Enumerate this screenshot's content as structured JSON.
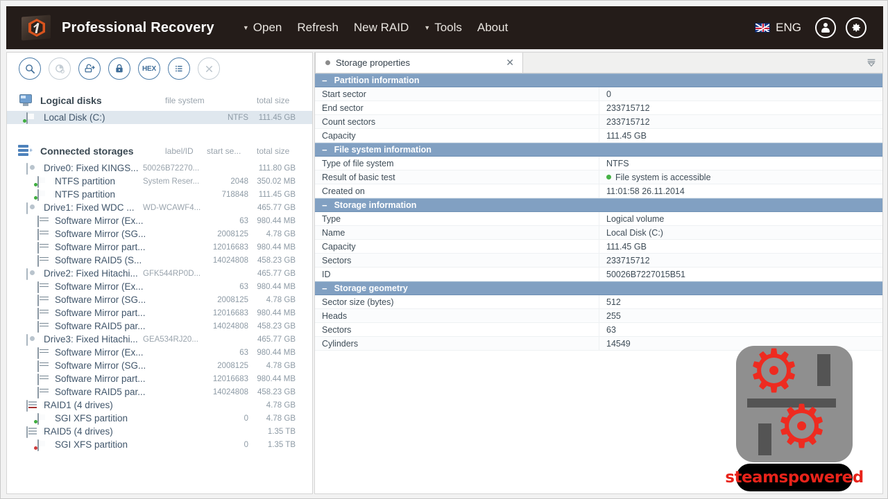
{
  "header": {
    "app_title": "Professional Recovery",
    "logo_icon": "recovery-folder-logo",
    "menu": [
      {
        "label": "Open",
        "caret": "▼"
      },
      {
        "label": "Refresh",
        "caret": ""
      },
      {
        "label": "New RAID",
        "caret": ""
      },
      {
        "label": "Tools",
        "caret": "▼"
      },
      {
        "label": "About",
        "caret": ""
      }
    ],
    "language": "ENG",
    "flag_icon": "uk-flag-icon",
    "user_icon": "user-icon",
    "settings_icon": "gear-icon"
  },
  "toolbar": {
    "buttons": [
      {
        "name": "search-icon",
        "glyph": "⌕",
        "disabled": false
      },
      {
        "name": "disk-usage-chart-icon",
        "glyph": "◔",
        "disabled": true
      },
      {
        "name": "disk-image-icon",
        "glyph": "⛃",
        "disabled": false
      },
      {
        "name": "lock-icon",
        "glyph": "ὑ2",
        "disabled": false
      },
      {
        "name": "hex-editor-icon",
        "glyph": "HEX",
        "disabled": false
      },
      {
        "name": "list-view-icon",
        "glyph": "☰",
        "disabled": false
      },
      {
        "name": "close-icon",
        "glyph": "✕",
        "disabled": true
      }
    ]
  },
  "logical_disks": {
    "title": "Logical disks",
    "icon": "monitor-icon",
    "columns": {
      "file_system": "file system",
      "total_size": "total size"
    },
    "rows": [
      {
        "icon": "partition-icon",
        "label": "Local Disk (C:)",
        "fs": "NTFS",
        "size": "111.45 GB",
        "selected": true
      }
    ]
  },
  "connected_storages": {
    "title": "Connected storages",
    "icon": "storages-stack-icon",
    "columns": {
      "label_id": "label/ID",
      "start_sector": "start se...",
      "total_size": "total size"
    },
    "rows": [
      {
        "icon": "drive-icon",
        "indent": 0,
        "label": "Drive0: Fixed KINGS...",
        "mid": "50026B72270...",
        "start": "",
        "size": "111.80 GB"
      },
      {
        "icon": "partition-icon",
        "indent": 1,
        "label": "NTFS partition",
        "mid": "System Reser...",
        "start": "2048",
        "size": "350.02 MB",
        "dot": "green"
      },
      {
        "icon": "partition-icon",
        "indent": 1,
        "label": "NTFS partition",
        "mid": "",
        "start": "718848",
        "size": "111.45 GB",
        "dot": "green"
      },
      {
        "icon": "drive-icon",
        "indent": 0,
        "label": "Drive1: Fixed WDC ...",
        "mid": "WD-WCAWF4...",
        "start": "",
        "size": "465.77 GB"
      },
      {
        "icon": "server-icon",
        "indent": 1,
        "label": "Software Mirror (Ex...",
        "mid": "",
        "start": "63",
        "size": "980.44 MB"
      },
      {
        "icon": "server-icon",
        "indent": 1,
        "label": "Software Mirror (SG...",
        "mid": "",
        "start": "2008125",
        "size": "4.78 GB"
      },
      {
        "icon": "server-icon",
        "indent": 1,
        "label": "Software Mirror part...",
        "mid": "",
        "start": "12016683",
        "size": "980.44 MB"
      },
      {
        "icon": "server-icon",
        "indent": 1,
        "label": "Software RAID5 (S...",
        "mid": "",
        "start": "14024808",
        "size": "458.23 GB"
      },
      {
        "icon": "drive-icon",
        "indent": 0,
        "label": "Drive2: Fixed Hitachi...",
        "mid": "GFK544RP0D...",
        "start": "",
        "size": "465.77 GB"
      },
      {
        "icon": "server-icon",
        "indent": 1,
        "label": "Software Mirror (Ex...",
        "mid": "",
        "start": "63",
        "size": "980.44 MB"
      },
      {
        "icon": "server-icon",
        "indent": 1,
        "label": "Software Mirror (SG...",
        "mid": "",
        "start": "2008125",
        "size": "4.78 GB"
      },
      {
        "icon": "server-icon",
        "indent": 1,
        "label": "Software Mirror part...",
        "mid": "",
        "start": "12016683",
        "size": "980.44 MB"
      },
      {
        "icon": "server-icon",
        "indent": 1,
        "label": "Software RAID5 par...",
        "mid": "",
        "start": "14024808",
        "size": "458.23 GB"
      },
      {
        "icon": "drive-icon",
        "indent": 0,
        "label": "Drive3: Fixed Hitachi...",
        "mid": "GEA534RJ20...",
        "start": "",
        "size": "465.77 GB"
      },
      {
        "icon": "server-icon",
        "indent": 1,
        "label": "Software Mirror (Ex...",
        "mid": "",
        "start": "63",
        "size": "980.44 MB"
      },
      {
        "icon": "server-icon",
        "indent": 1,
        "label": "Software Mirror (SG...",
        "mid": "",
        "start": "2008125",
        "size": "4.78 GB"
      },
      {
        "icon": "server-icon",
        "indent": 1,
        "label": "Software Mirror part...",
        "mid": "",
        "start": "12016683",
        "size": "980.44 MB"
      },
      {
        "icon": "server-icon",
        "indent": 1,
        "label": "Software RAID5 par...",
        "mid": "",
        "start": "14024808",
        "size": "458.23 GB"
      },
      {
        "icon": "raid-alert-icon",
        "indent": 0,
        "label": "RAID1 (4 drives)",
        "mid": "",
        "start": "",
        "size": "4.78 GB"
      },
      {
        "icon": "partition-icon",
        "indent": 1,
        "label": "SGI XFS partition",
        "mid": "",
        "start": "0",
        "size": "4.78 GB",
        "dot": "green"
      },
      {
        "icon": "raid-icon",
        "indent": 0,
        "label": "RAID5 (4 drives)",
        "mid": "",
        "start": "",
        "size": "1.35 TB"
      },
      {
        "icon": "partition-icon",
        "indent": 1,
        "label": "SGI XFS partition",
        "mid": "",
        "start": "0",
        "size": "1.35 TB",
        "dot": "red"
      }
    ]
  },
  "properties_panel": {
    "tab": {
      "label": "Storage properties",
      "close_label": "✕",
      "menu_icon": "tab-list-menu-icon"
    },
    "groups": [
      {
        "title": "Partition information",
        "collapse": "−",
        "rows": [
          {
            "key": "Start sector",
            "value": "0"
          },
          {
            "key": "End sector",
            "value": "233715712"
          },
          {
            "key": "Count sectors",
            "value": "233715712"
          },
          {
            "key": "Capacity",
            "value": "111.45 GB"
          }
        ]
      },
      {
        "title": "File system information",
        "collapse": "−",
        "rows": [
          {
            "key": "Type of file system",
            "value": "NTFS"
          },
          {
            "key": "Result of basic test",
            "value": "File system is accessible",
            "status": "ok"
          },
          {
            "key": "Created on",
            "value": "11:01:58 26.11.2014"
          }
        ]
      },
      {
        "title": "Storage information",
        "collapse": "−",
        "rows": [
          {
            "key": "Type",
            "value": "Logical volume"
          },
          {
            "key": "Name",
            "value": "Local Disk (C:)"
          },
          {
            "key": "Capacity",
            "value": "111.45 GB"
          },
          {
            "key": "Sectors",
            "value": "233715712"
          },
          {
            "key": "ID",
            "value": "50026B7227015B51"
          }
        ]
      },
      {
        "title": "Storage geometry",
        "collapse": "−",
        "rows": [
          {
            "key": "Sector size (bytes)",
            "value": "512"
          },
          {
            "key": "Heads",
            "value": "255"
          },
          {
            "key": "Sectors",
            "value": "63"
          },
          {
            "key": "Cylinders",
            "value": "14549"
          }
        ]
      }
    ]
  },
  "watermark": {
    "name": "steamspowered",
    "icon": "steamspowered-logo"
  },
  "colors": {
    "header_bg": "#241c19",
    "accent_orange": "#d9541e",
    "group_header": "#81a0c2",
    "selection": "#dfe7ee",
    "status_ok": "#46b246",
    "status_error": "#cf3b3b",
    "watermark_red": "#ee2b20"
  }
}
